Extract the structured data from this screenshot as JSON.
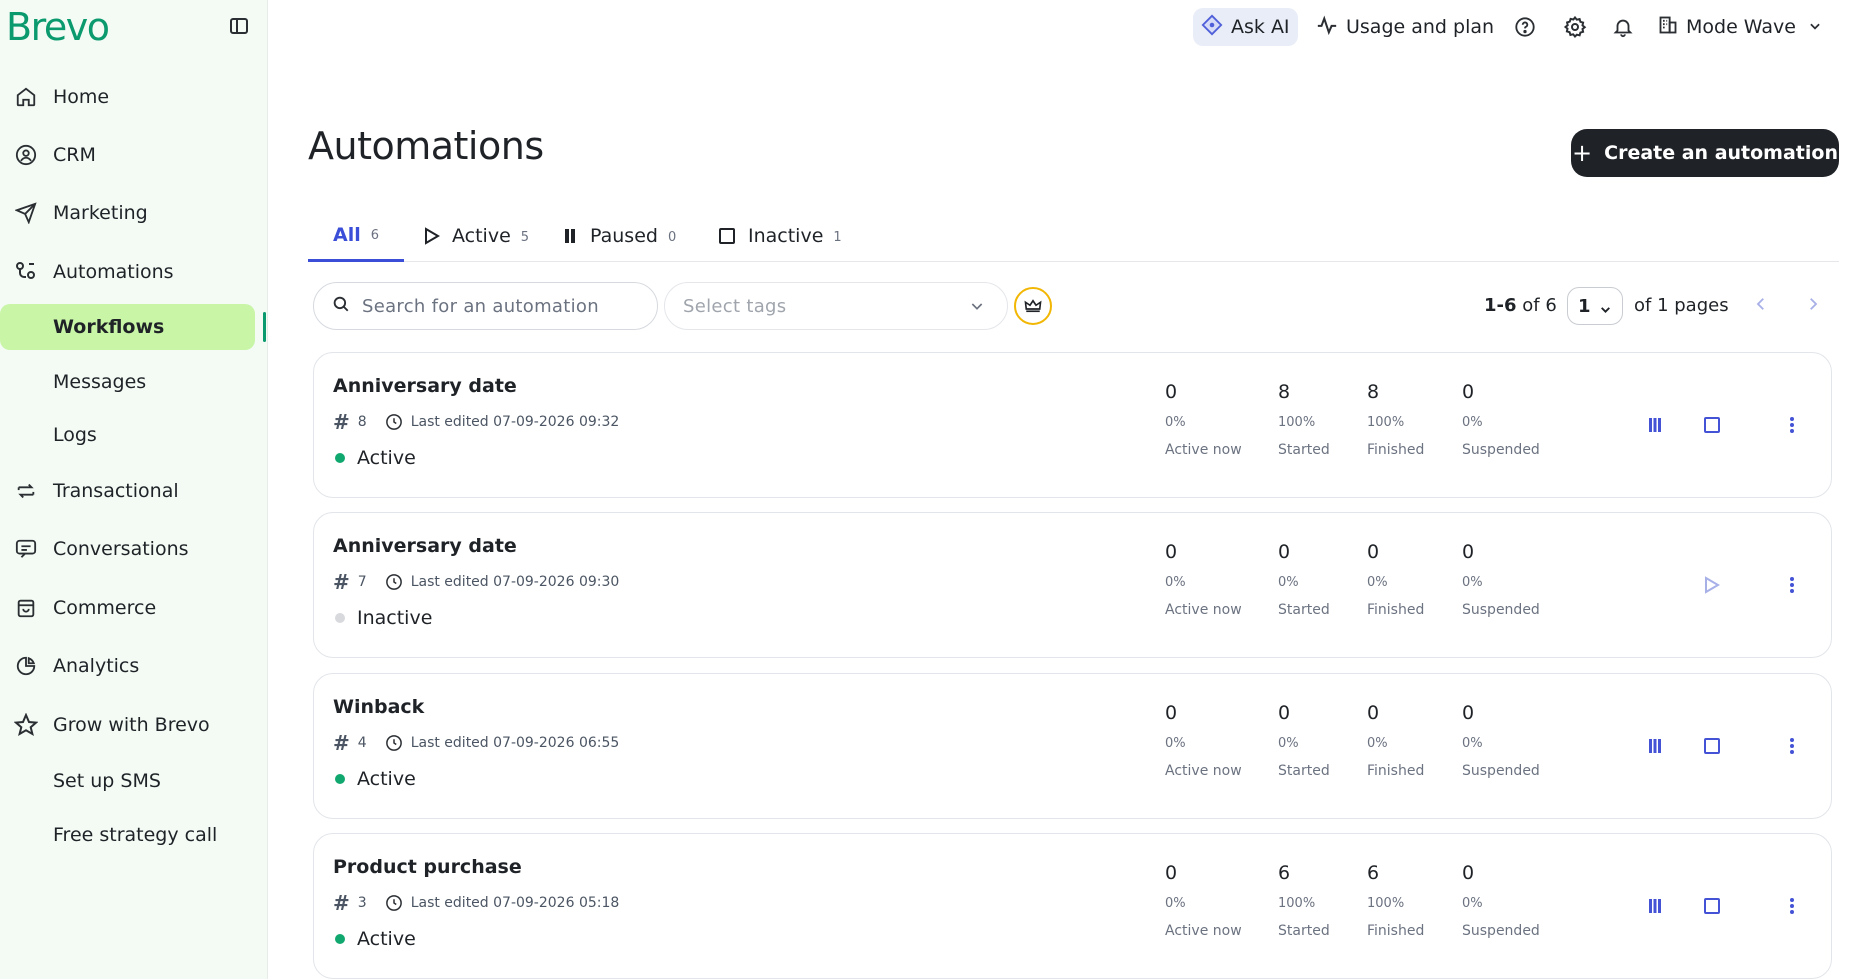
{
  "brand": {
    "logo_text": "Brevo",
    "accent": "#0b996e",
    "highlight": "#c8f5a6",
    "link": "#3b4ed8"
  },
  "sidebar": {
    "items": [
      {
        "label": "Home",
        "icon": "home-icon"
      },
      {
        "label": "CRM",
        "icon": "contacts-icon"
      },
      {
        "label": "Marketing",
        "icon": "send-icon"
      },
      {
        "label": "Automations",
        "icon": "automation-icon"
      },
      {
        "label": "Workflows",
        "sub": true,
        "active": true
      },
      {
        "label": "Messages",
        "sub": true
      },
      {
        "label": "Logs",
        "sub": true
      },
      {
        "label": "Transactional",
        "icon": "arrows-swap-icon"
      },
      {
        "label": "Conversations",
        "icon": "chat-icon"
      },
      {
        "label": "Commerce",
        "icon": "shopping-bag-icon"
      },
      {
        "label": "Analytics",
        "icon": "pie-chart-icon"
      },
      {
        "label": "Grow with Brevo",
        "icon": "star-icon"
      },
      {
        "label": "Set up SMS",
        "sub": true
      },
      {
        "label": "Free strategy call",
        "sub": true
      }
    ]
  },
  "topbar": {
    "ask_ai": "Ask AI",
    "usage": "Usage and plan",
    "account": "Mode Wave"
  },
  "main": {
    "title": "Automations",
    "create_label": "Create an automation",
    "tabs": [
      {
        "label": "All",
        "count": "6",
        "active": true
      },
      {
        "label": "Active",
        "count": "5"
      },
      {
        "label": "Paused",
        "count": "0"
      },
      {
        "label": "Inactive",
        "count": "1"
      }
    ],
    "search_placeholder": "Search for an automation",
    "tags_placeholder": "Select tags",
    "pager": {
      "range": "1-6",
      "of_total": "of 6",
      "page": "1",
      "of_pages": "of 1 pages"
    }
  },
  "cards": [
    {
      "title": "Anniversary date",
      "id": "8",
      "edited": "Last edited 07-09-2026 09:32",
      "status": "Active",
      "stats": [
        {
          "v": "0",
          "p": "0%",
          "l": "Active now"
        },
        {
          "v": "8",
          "p": "100%",
          "l": "Started"
        },
        {
          "v": "8",
          "p": "100%",
          "l": "Finished"
        },
        {
          "v": "0",
          "p": "0%",
          "l": "Suspended"
        }
      ]
    },
    {
      "title": "Anniversary date",
      "id": "7",
      "edited": "Last edited 07-09-2026 09:30",
      "status": "Inactive",
      "stats": [
        {
          "v": "0",
          "p": "0%",
          "l": "Active now"
        },
        {
          "v": "0",
          "p": "0%",
          "l": "Started"
        },
        {
          "v": "0",
          "p": "0%",
          "l": "Finished"
        },
        {
          "v": "0",
          "p": "0%",
          "l": "Suspended"
        }
      ]
    },
    {
      "title": "Winback",
      "id": "4",
      "edited": "Last edited 07-09-2026 06:55",
      "status": "Active",
      "stats": [
        {
          "v": "0",
          "p": "0%",
          "l": "Active now"
        },
        {
          "v": "0",
          "p": "0%",
          "l": "Started"
        },
        {
          "v": "0",
          "p": "0%",
          "l": "Finished"
        },
        {
          "v": "0",
          "p": "0%",
          "l": "Suspended"
        }
      ]
    },
    {
      "title": "Product purchase",
      "id": "3",
      "edited": "Last edited 07-09-2026 05:18",
      "status": "Active",
      "stats": [
        {
          "v": "0",
          "p": "0%",
          "l": "Active now"
        },
        {
          "v": "6",
          "p": "100%",
          "l": "Started"
        },
        {
          "v": "6",
          "p": "100%",
          "l": "Finished"
        },
        {
          "v": "0",
          "p": "0%",
          "l": "Suspended"
        }
      ]
    }
  ]
}
